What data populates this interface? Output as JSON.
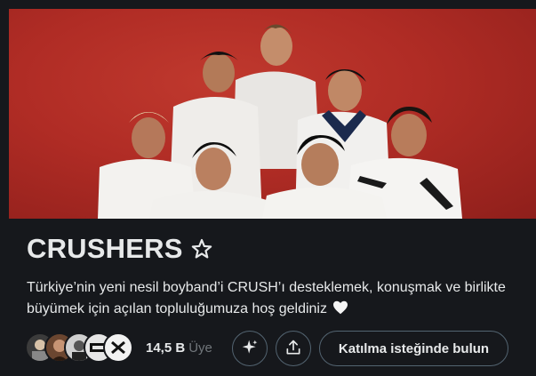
{
  "community": {
    "name": "CRUSHERS",
    "name_icon": "star-outline-icon",
    "description": "Türkiye’nin yeni nesil boyband’i CRUSH’ı desteklemek, konuşmak ve birlikte büyümek için açılan topluluğumuza hoş geldiniz",
    "description_end_icon": "white-heart-icon",
    "banner_image": "group-photo-banner",
    "member_count": "14,5 B",
    "member_unit": "Üye"
  },
  "actions": {
    "sparkle_icon": "sparkle-icon",
    "share_icon": "share-icon",
    "join_label": "Katılma isteğinde bulun"
  },
  "colors": {
    "background": "#16181c",
    "banner_red": "#b02c25",
    "text_primary": "#e7e9ea",
    "text_secondary": "#71767b",
    "button_border": "#536471"
  }
}
